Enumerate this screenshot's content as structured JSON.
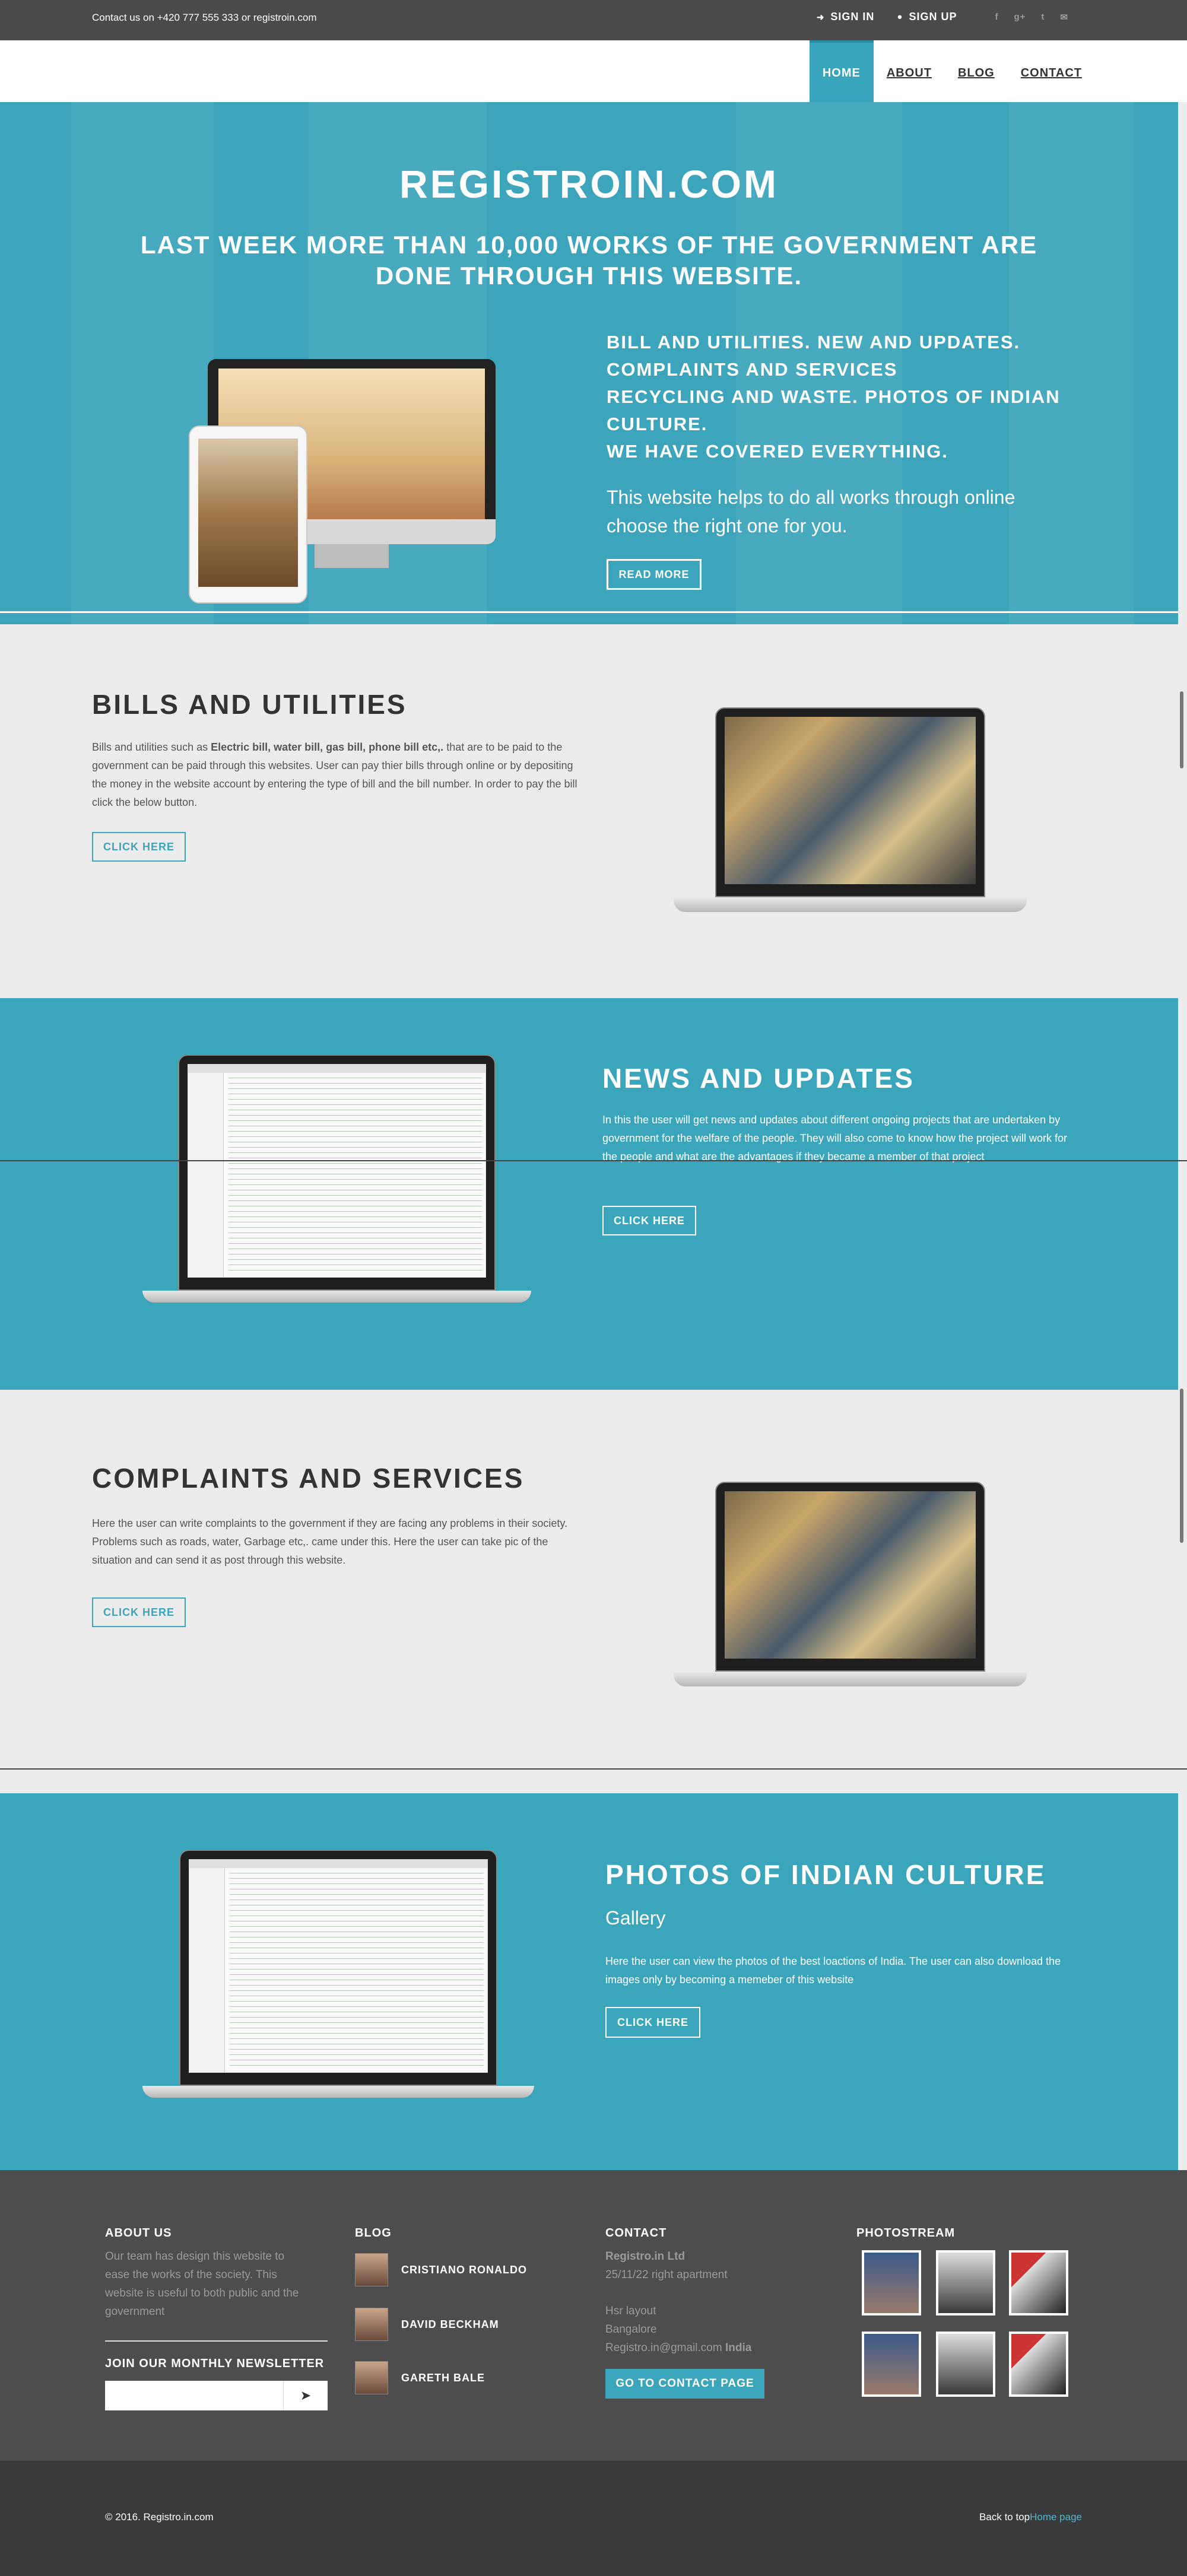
{
  "topbar": {
    "contact": "Contact us on +420 777 555 333 or registroin.com",
    "sign_in": "SIGN IN",
    "sign_up": "SIGN UP",
    "social_icons": [
      "facebook-icon",
      "google-plus-icon",
      "twitter-icon",
      "email-icon"
    ]
  },
  "nav": {
    "items": [
      {
        "label": "HOME",
        "active": true
      },
      {
        "label": "ABOUT",
        "active": false
      },
      {
        "label": "BLOG",
        "active": false
      },
      {
        "label": "CONTACT",
        "active": false
      }
    ]
  },
  "hero": {
    "title": "REGISTROIN.COM",
    "subtitle": "LAST WEEK MORE THAN 10,000 WORKS OF THE GOVERNMENT ARE DONE THROUGH THIS WEBSITE.",
    "features": [
      "BILL AND UTILITIES. NEW AND UPDATES.",
      "COMPLAINTS AND SERVICES",
      "RECYCLING AND WASTE. PHOTOS OF INDIAN CULTURE.",
      "WE HAVE COVERED EVERYTHING."
    ],
    "description": "This website helps to do all works through online choose the right one for you.",
    "button": "READ MORE"
  },
  "sections": {
    "bills": {
      "title": "BILLS AND UTILITIES",
      "text_pre": "Bills and utilities such as ",
      "text_bold": "Electric bill, water bill, gas bill, phone bill etc,.",
      "text_post": " that are to be paid to the government can be paid through this websites. User can pay thier bills through online or by depositing the money in the website account by entering the type of bill and the bill number. In order to pay the bill click the below button.",
      "button": "CLICK HERE"
    },
    "news": {
      "title": "NEWS AND UPDATES",
      "text": "In this the user will get news and updates about different ongoing projects that are undertaken by government for the welfare of the people. They will also come to know how the project will work for the people and what are the advantages if they became a member of that project",
      "button": "CLICK HERE"
    },
    "complaints": {
      "title": "COMPLAINTS AND SERVICES",
      "text": "Here the user can write complaints to the government if they are facing any problems in their society. Problems such as roads, water, Garbage etc,. came under this. Here the user can take pic of the situation and can send it as post through this website.",
      "button": "CLICK HERE"
    },
    "photos": {
      "title": "PHOTOS OF INDIAN CULTURE",
      "subtitle": "Gallery",
      "text": "Here the user can view the photos of the best loactions of India. The user can also download the images only by becoming a memeber of this website",
      "button": "CLICK HERE"
    }
  },
  "footer": {
    "about": {
      "heading": "ABOUT US",
      "text": "Our team has design this website to ease the works of the society. This website is useful to both public and the government"
    },
    "newsletter": {
      "heading": "JOIN OUR MONTHLY NEWSLETTER",
      "placeholder": ""
    },
    "blog": {
      "heading": "BLOG",
      "items": [
        "CRISTIANO RONALDO",
        "DAVID BECKHAM",
        "GARETH BALE"
      ]
    },
    "contact": {
      "heading": "CONTACT",
      "company": "Registro.in Ltd",
      "address": "25/11/22 right apartment",
      "layout": "Hsr layout",
      "city": "Bangalore",
      "email": "Registro.in@gmail.com",
      "country": "India",
      "button": "GO TO CONTACT PAGE"
    },
    "photostream": {
      "heading": "PHOTOSTREAM"
    }
  },
  "bottombar": {
    "copyright": "© 2016. Registro.in.com",
    "back_text": "Back to top",
    "home_link": "Home page"
  },
  "colors": {
    "accent": "#38a5bc",
    "dark": "#4a4a4a",
    "footer": "#4d4d4d",
    "bottom": "#3a3a3a"
  }
}
